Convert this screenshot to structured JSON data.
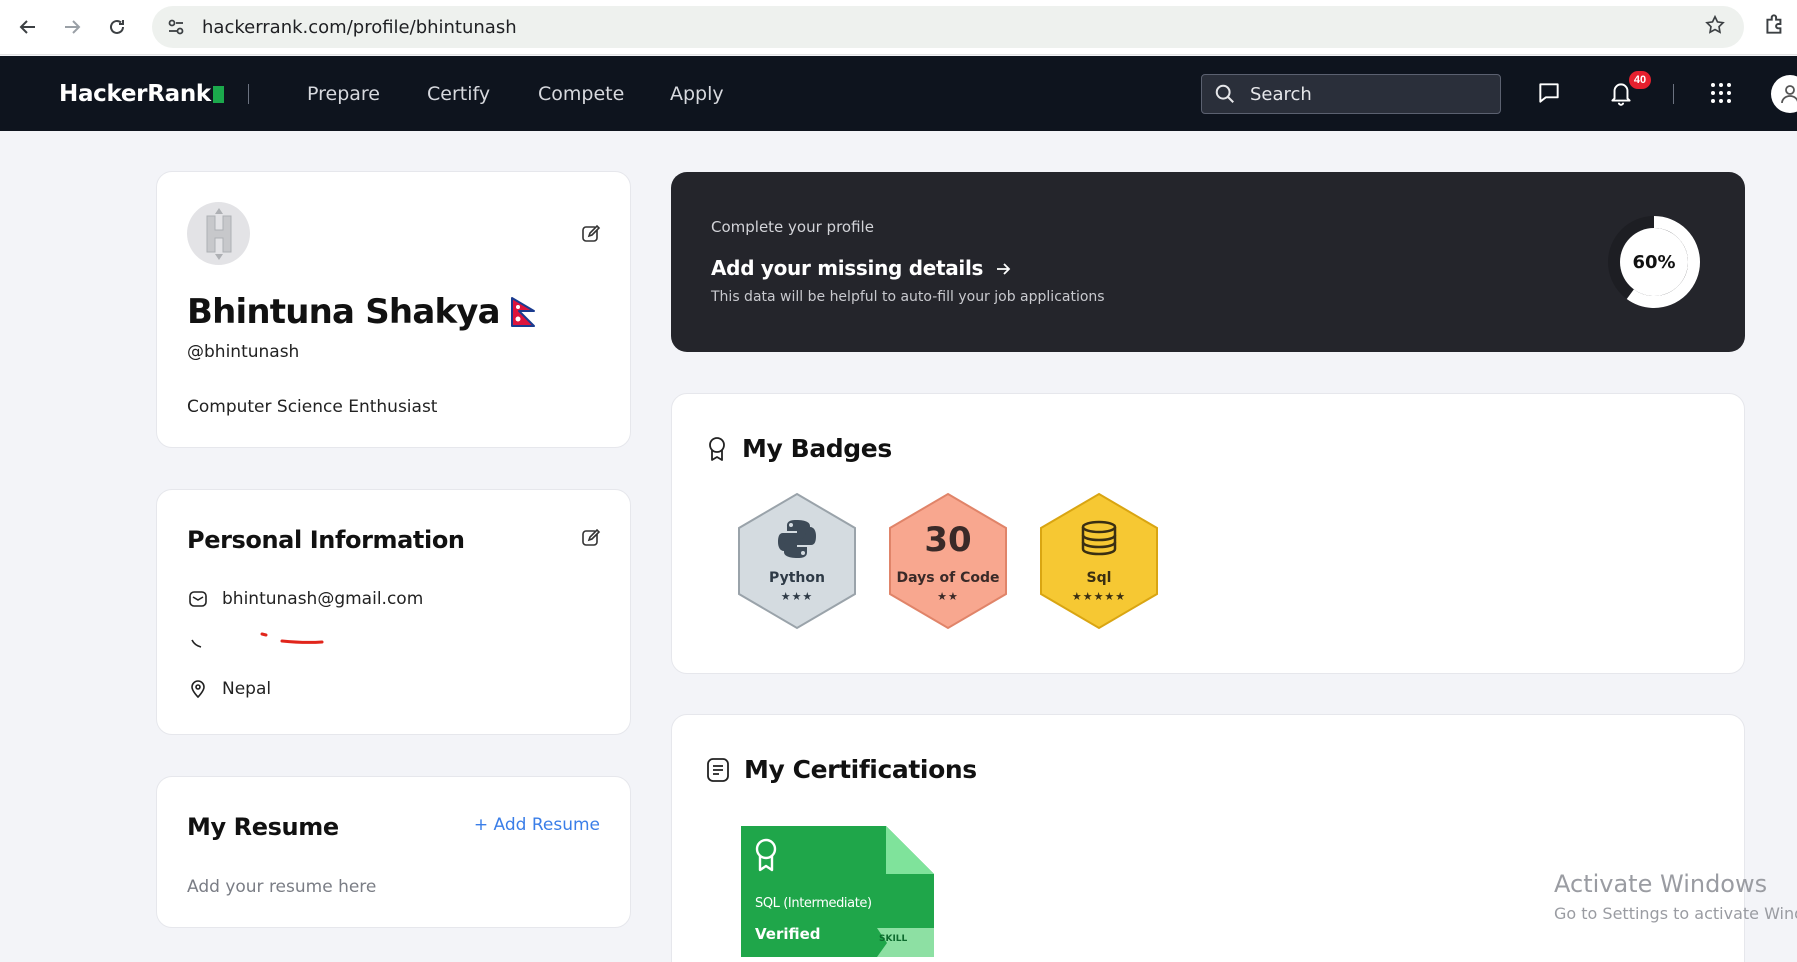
{
  "browser": {
    "url": "hackerrank.com/profile/bhintunash"
  },
  "header": {
    "logo": "HackerRank",
    "nav": [
      "Prepare",
      "Certify",
      "Compete",
      "Apply"
    ],
    "search_label": "Search",
    "notification_count": "40"
  },
  "profile": {
    "name": "Bhintuna Shakya",
    "handle": "@bhintunash",
    "bio": "Computer Science Enthusiast"
  },
  "personal_info": {
    "title": "Personal Information",
    "email": "bhintunash@gmail.com",
    "location": "Nepal"
  },
  "resume": {
    "title": "My Resume",
    "add_label": "+ Add Resume",
    "empty_text": "Add your resume here"
  },
  "banner": {
    "pre": "Complete your profile",
    "cta": "Add your missing details",
    "sub": "This data will be helpful to auto-fill your job applications",
    "progress_label": "60%",
    "progress_fraction": 0.6
  },
  "badges": {
    "title": "My Badges",
    "items": [
      {
        "label": "Python",
        "stars": "★★★",
        "fill": "#d4dbe0",
        "stroke": "#9aa3aa"
      },
      {
        "label": "Days of Code",
        "number": "30",
        "stars": "★★",
        "fill": "#f8a78f",
        "stroke": "#e08469"
      },
      {
        "label": "Sql",
        "stars": "★★★★★",
        "fill": "#f6c833",
        "stroke": "#d9a512"
      }
    ]
  },
  "certifications": {
    "title": "My Certifications",
    "items": [
      {
        "label": "SQL (Intermediate)",
        "status": "Verified",
        "tag": "SKILL"
      }
    ]
  },
  "watermark": {
    "line1": "Activate Windows",
    "line2": "Go to Settings to activate Windows."
  },
  "colors": {
    "brand_green": "#1ba94c",
    "header_bg": "#0e141e",
    "banner_bg": "#24252b",
    "link_blue": "#3a7ee8",
    "notif_red": "#e5202e"
  }
}
